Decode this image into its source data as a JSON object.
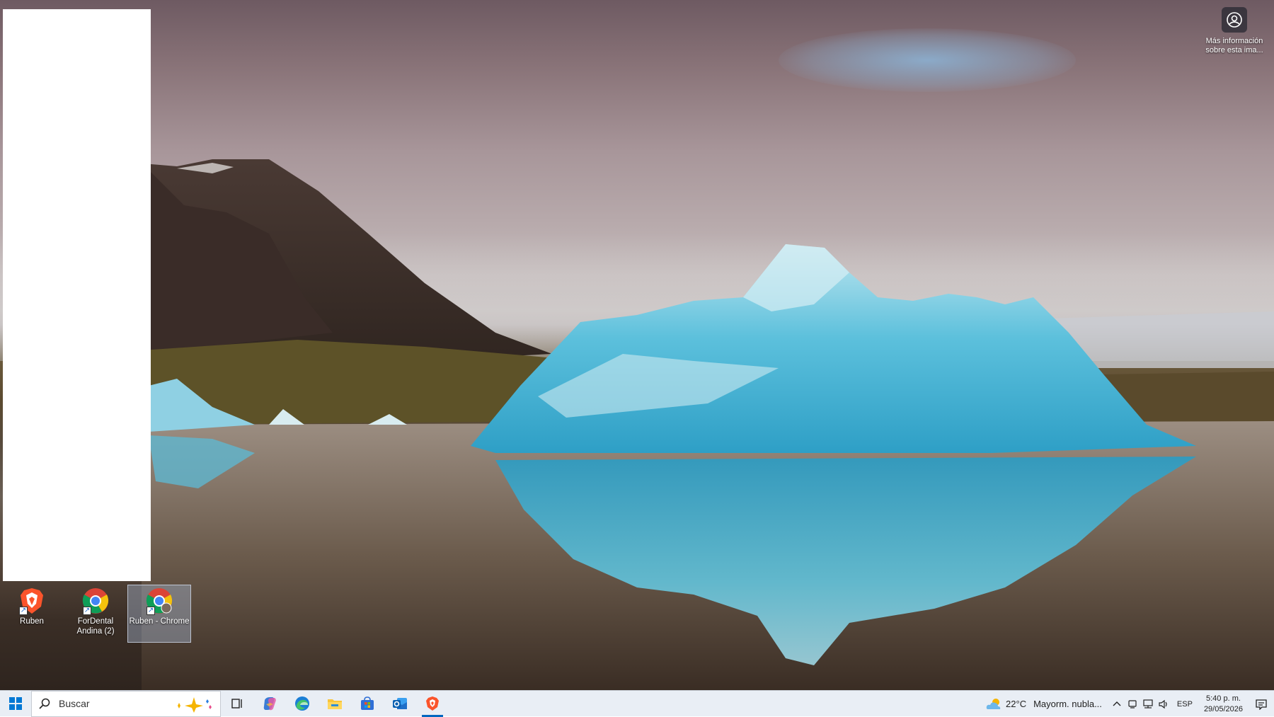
{
  "desktop": {
    "info_button": {
      "icon": "camera-info-icon",
      "label": "Más información sobre esta ima..."
    },
    "icons": [
      {
        "icon": "brave-shortcut-icon",
        "label": "Ruben",
        "selected": false
      },
      {
        "icon": "chrome-shortcut-icon",
        "label": "ForDental Andina (2)",
        "selected": false
      },
      {
        "icon": "chrome-profile-shortcut-icon",
        "label": "Ruben - Chrome",
        "selected": true
      }
    ]
  },
  "taskbar": {
    "start_icon": "windows-start-icon",
    "search": {
      "placeholder": "Buscar",
      "icon": "search-icon",
      "decor_icon": "copilot-sparkle-icon"
    },
    "apps": [
      {
        "name": "task-view",
        "icon": "task-view-icon"
      },
      {
        "name": "copilot",
        "icon": "copilot-icon"
      },
      {
        "name": "edge",
        "icon": "edge-icon"
      },
      {
        "name": "file-explorer",
        "icon": "folder-icon"
      },
      {
        "name": "store",
        "icon": "store-icon"
      },
      {
        "name": "outlook",
        "icon": "outlook-icon"
      },
      {
        "name": "brave",
        "icon": "brave-icon",
        "active": true
      }
    ],
    "weather": {
      "temp": "22°C",
      "condition": "Mayorm. nubla...",
      "icon": "cloudy-weather-icon"
    },
    "tray": {
      "icons": [
        "chevron-up-icon",
        "meet-now-icon",
        "network-icon",
        "volume-icon"
      ],
      "language": "ESP",
      "time": "5:40 p. m.",
      "date": "29/05/2026",
      "notification_icon": "notification-icon"
    }
  },
  "colors": {
    "taskbar_bg": "#e9eef5",
    "accent": "#0067c0",
    "brave_orange": "#fb542b"
  }
}
